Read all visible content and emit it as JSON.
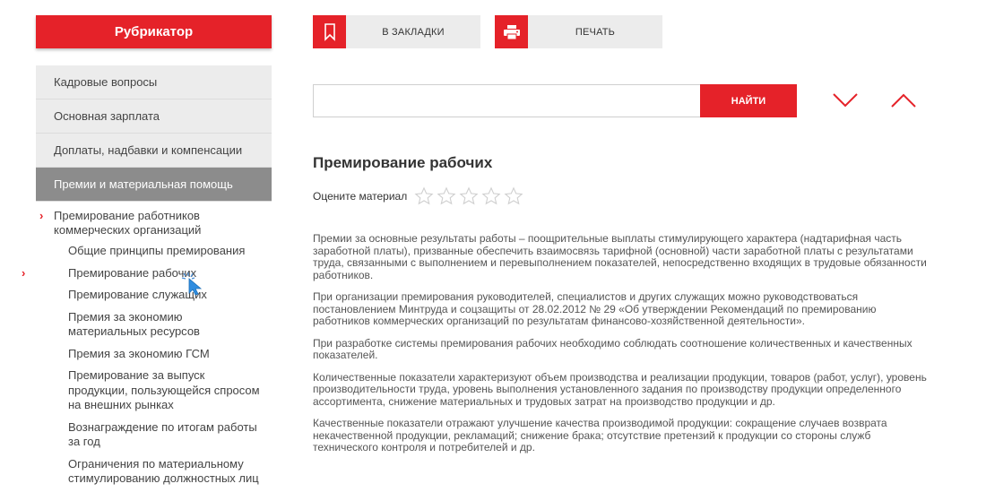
{
  "sidebar": {
    "title": "Рубрикатор",
    "menu": [
      {
        "label": "Кадровые вопросы"
      },
      {
        "label": "Основная зарплата"
      },
      {
        "label": "Доплаты, надбавки и компенсации"
      },
      {
        "label": "Премии и материальная помощь"
      }
    ],
    "section": "Премирование работников коммерческих организаций",
    "subitems": [
      {
        "label": "Общие принципы премирования"
      },
      {
        "label": "Премирование рабочих"
      },
      {
        "label": "Премирование служащих"
      },
      {
        "label": "Премия за экономию материальных ресурсов"
      },
      {
        "label": "Премия за экономию ГСМ"
      },
      {
        "label": "Премирование за выпуск продукции, пользующейся спросом на внешних рынках"
      },
      {
        "label": "Вознаграждение по итогам работы за год"
      },
      {
        "label": "Ограничения по материальному стимулированию должностных лиц"
      }
    ]
  },
  "toolbar": {
    "bookmark_label": "В ЗАКЛАДКИ",
    "print_label": "ПЕЧАТЬ"
  },
  "search": {
    "value": "",
    "placeholder": "",
    "button_label": "НАЙТИ"
  },
  "article": {
    "title": "Премирование рабочих",
    "rate_label": "Оцените материал",
    "rating": {
      "value": 0,
      "max": 5
    },
    "paragraphs": [
      "Премии за основные результаты работы – поощрительные выплаты стимулирующего характера (надтарифная часть заработной платы), призванные обеспечить взаимосвязь тарифной (основной) части заработной платы с результатами труда, связанными с выполнением и перевыполнением показателей, непосредственно входящих в трудовые обязанности работников.",
      "При организации премирования руководителей, специалистов и других служащих можно руководствоваться постановлением Минтруда и соцзащиты от 28.02.2012 № 29 «Об утверждении Рекомендаций по премированию работников коммерческих организаций по результатам финансово-хозяйственной деятельности».",
      "При разработке системы премирования рабочих необходимо соблюдать соотношение количественных и качественных показателей.",
      "Количественные показатели характеризуют объем производства и реализации продукции, товаров (работ, услуг), уровень производительности труда, уровень выполнения установленного задания по производству продукции определенного ассортимента, снижение материальных и трудовых затрат на производство продукции и др.",
      "Качественные показатели отражают улучшение качества производимой продукции: сокращение случаев возврата некачественной продукции, рекламаций; снижение брака; отсутствие претензий к продукции со стороны служб технического контроля и потребителей и др."
    ]
  },
  "colors": {
    "accent": "#e52229",
    "menu_bg": "#ececec",
    "menu_active_bg": "#8c8c8c"
  },
  "icons": {
    "bookmark": "bookmark-icon",
    "print": "printer-icon",
    "next": "chevron-down-icon",
    "prev": "chevron-up-icon",
    "star": "star-outline-icon",
    "chevron": "chevron-right-icon"
  }
}
